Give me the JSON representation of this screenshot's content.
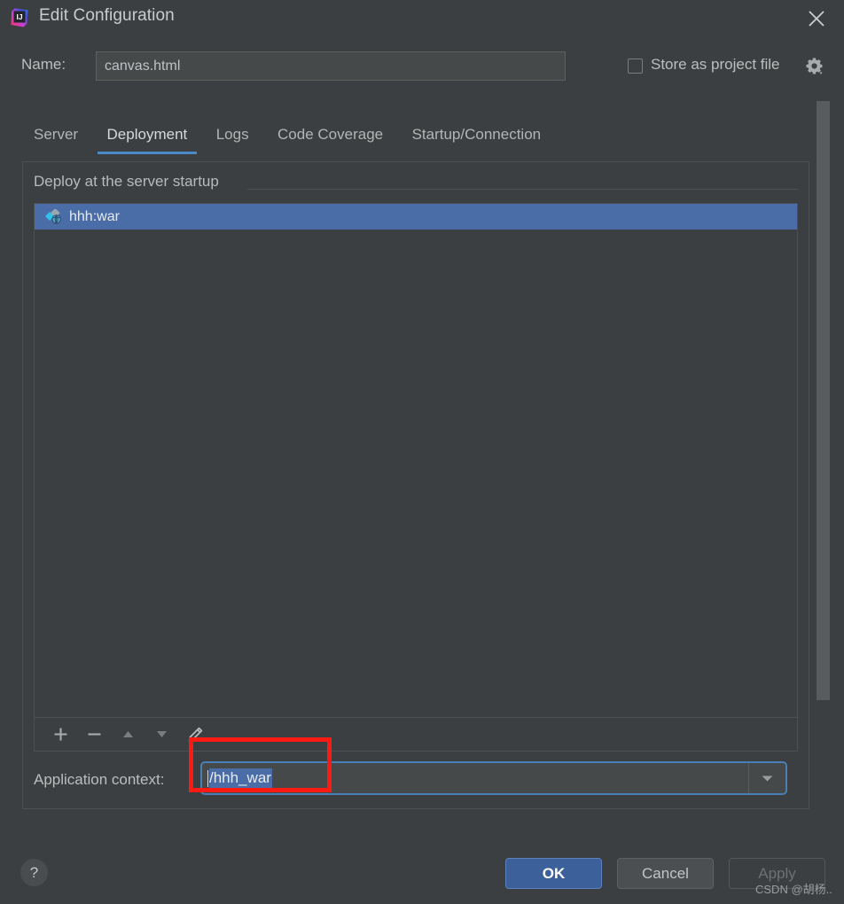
{
  "window": {
    "title": "Edit Configuration",
    "logo_icon": "intellij-idea-logo",
    "close_icon": "close-icon"
  },
  "name_row": {
    "label": "Name:",
    "value": "canvas.html",
    "placeholder": "",
    "store_as_project_file": {
      "label": "Store as project file",
      "checked": false
    },
    "gear_icon": "gear-dropdown-icon"
  },
  "tabs": [
    {
      "label": "Server",
      "active": false
    },
    {
      "label": "Deployment",
      "active": true
    },
    {
      "label": "Logs",
      "active": false
    },
    {
      "label": "Code Coverage",
      "active": false
    },
    {
      "label": "Startup/Connection",
      "active": false
    }
  ],
  "deployment": {
    "group_title": "Deploy at the server startup",
    "items": [
      {
        "label": "hhh:war",
        "icon": "artifact-war-icon",
        "selected": true
      }
    ],
    "toolbar": [
      {
        "name": "add-button",
        "icon": "plus-icon",
        "label": "+"
      },
      {
        "name": "remove-button",
        "icon": "minus-icon",
        "label": "−"
      },
      {
        "name": "move-up-button",
        "icon": "arrow-up-icon",
        "label": "▲"
      },
      {
        "name": "move-down-button",
        "icon": "arrow-down-icon",
        "label": "▼"
      },
      {
        "name": "edit-button",
        "icon": "pencil-edit-icon",
        "label": "✎"
      }
    ],
    "application_context": {
      "label": "Application context:",
      "value": "/hhh_war",
      "selected": true,
      "dropdown_icon": "chevron-down-icon"
    }
  },
  "footer": {
    "help_label": "?",
    "ok_label": "OK",
    "cancel_label": "Cancel",
    "apply_label": "Apply",
    "apply_enabled": false
  },
  "watermark": "CSDN @胡杨..",
  "colors": {
    "background": "#3c3f41",
    "selection_blue": "#4a6da7",
    "accent_blue": "#4a88c7",
    "focus_border": "#4a7fb5",
    "ok_button": "#3c6099",
    "annotation_red": "#fb1b12",
    "field_background": "#45494a",
    "text_primary": "#bbbbbb"
  }
}
